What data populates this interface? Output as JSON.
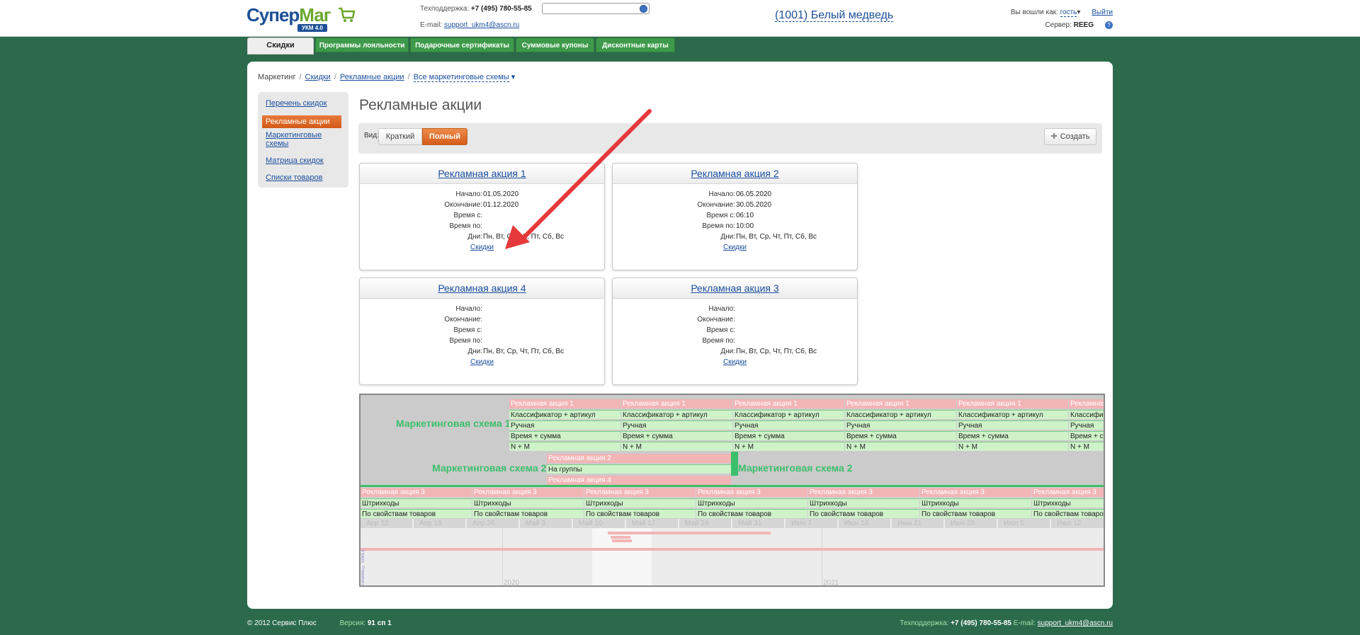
{
  "header": {
    "logo": {
      "part1": "Супер",
      "part2": "Маг",
      "version": "УКМ 4.0"
    },
    "support_label": "Техподдержка:",
    "support_phone": "+7 (495) 780-55-85",
    "email_label": "E-mail:",
    "email": "support_ukm4@ascn.ru",
    "store": "(1001) Белый медведь",
    "logged_label": "Вы вошли как:",
    "login": "гость",
    "logout": "Выйти",
    "server_label": "Сервер:",
    "server": "REEG"
  },
  "nav_tabs": [
    {
      "label": "Скидки"
    },
    {
      "label": "Программы лояльности"
    },
    {
      "label": "Подарочные сертификаты"
    },
    {
      "label": "Суммовые купоны"
    },
    {
      "label": "Дисконтные карты"
    }
  ],
  "breadcrumb": {
    "root": "Маркетинг",
    "c1": "Скидки",
    "c2": "Рекламные акции",
    "c3": "Все маркетинговые схемы",
    "sep": "/"
  },
  "sidebar": {
    "items": [
      {
        "label": "Перечень скидок"
      },
      {
        "label": "Рекламные акции"
      },
      {
        "label": "Маркетинговые схемы"
      },
      {
        "label": "Матрица скидок"
      },
      {
        "label": "Списки товаров"
      }
    ]
  },
  "page_title": "Рекламные акции",
  "toolbar": {
    "view_label": "Вид:",
    "short": "Краткий",
    "full": "Полный",
    "create": "Создать"
  },
  "labels": {
    "start": "Начало:",
    "end": "Окончание:",
    "time_from": "Время с:",
    "time_to": "Время по:",
    "days": "Дни:",
    "discounts": "Скидки"
  },
  "cards": [
    {
      "title": "Рекламная акция 1",
      "start": "01.05.2020",
      "end": "01.12.2020",
      "time_from": "",
      "time_to": "",
      "days": "Пн, Вт, Ср, Чт, Пт, Сб, Вс"
    },
    {
      "title": "Рекламная акция 2",
      "start": "06.05.2020",
      "end": "30.05.2020",
      "time_from": "06:10",
      "time_to": "10:00",
      "days": "Пн, Вт, Ср, Чт, Пт, Сб, Вс"
    },
    {
      "title": "Рекламная акция 4",
      "start": "",
      "end": "",
      "time_from": "",
      "time_to": "",
      "days": "Пн, Вт, Ср, Чт, Пт, Сб, Вс"
    },
    {
      "title": "Рекламная акция 3",
      "start": "",
      "end": "",
      "time_from": "",
      "time_to": "",
      "days": "Пн, Вт, Ср, Чт, Пт, Сб, Вс"
    }
  ],
  "gantt": {
    "scheme1": "Маркетинговая схема 1",
    "scheme2": "Маркетинговая схема 2",
    "a1": "Рекламная акция 1",
    "a2": "Рекламная акция 2",
    "a3": "Рекламная акция 3",
    "a4": "Рекламная акция 4",
    "r_class": "Классификатор + артикул",
    "r_manual": "Ручная",
    "r_time": "Время + сумма",
    "r_nm": "N + M",
    "r_groups": "На группы",
    "r_barcodes": "Штрихкоды",
    "r_props": "По свойствам товаров",
    "months": [
      "Апр 12",
      "Апр 19",
      "Апр 26",
      "Май 3",
      "Май 10",
      "Май 17",
      "Май 24",
      "Май 31",
      "Июн 7",
      "Июн 14",
      "Июн 21",
      "Июн 28",
      "Июл 5",
      "Июл 12"
    ],
    "years": [
      "2020",
      "2021"
    ],
    "credit": "Timeline © SIMILE"
  },
  "footer": {
    "copyright": "© 2012 Сервис Плюс",
    "version_label": "Версия:",
    "version": "91 сп 1",
    "support_label": "Техподдержка:",
    "phone": "+7 (495) 780-55-85",
    "email_label": "E-mail:",
    "email": "support_ukm4@ascn.ru"
  },
  "colors": {
    "accent_orange": "#d55d1b",
    "nav_green": "#3e9a4a",
    "bg_green": "#2c6a4c",
    "link_blue": "#1a4f9e"
  }
}
